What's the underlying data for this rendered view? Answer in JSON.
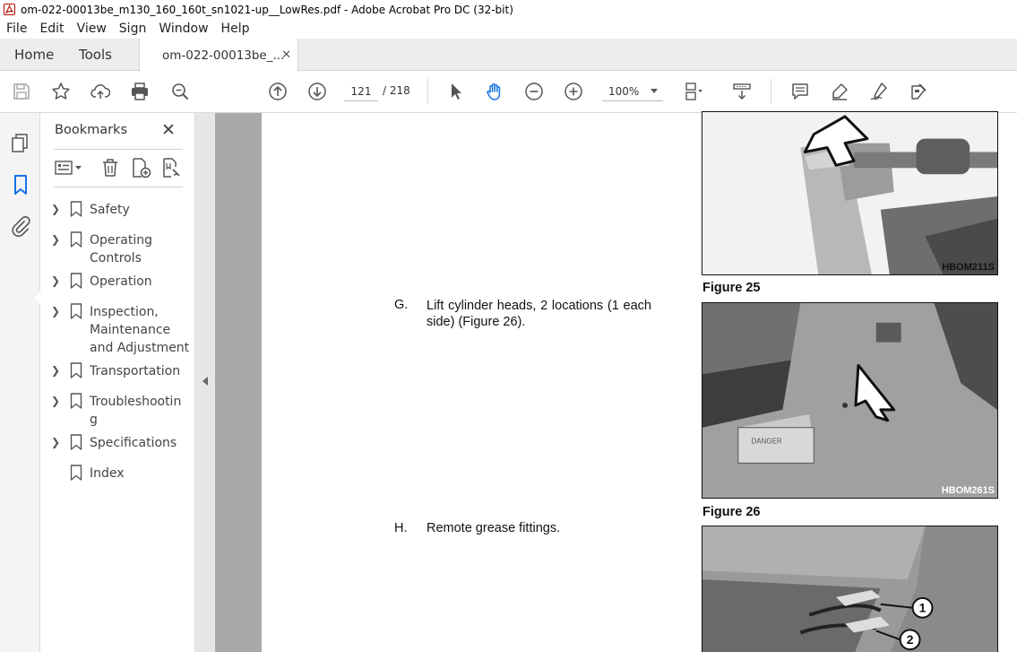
{
  "window": {
    "title": "om-022-00013be_m130_160_160t_sn1021-up__LowRes.pdf - Adobe Acrobat Pro DC (32-bit)"
  },
  "menu": [
    "File",
    "Edit",
    "View",
    "Sign",
    "Window",
    "Help"
  ],
  "tabs": {
    "home": "Home",
    "tools": "Tools",
    "document": "om-022-00013be_..."
  },
  "toolbar": {
    "current_page": "121",
    "total_pages": "/ 218",
    "zoom": "100%"
  },
  "bookmarks": {
    "title": "Bookmarks",
    "items": [
      {
        "label": "Safety",
        "expandable": true
      },
      {
        "label": "Operating Controls",
        "expandable": true
      },
      {
        "label": "Operation",
        "expandable": true
      },
      {
        "label": "Inspection, Maintenance and Adjustment",
        "expandable": true
      },
      {
        "label": "Transportation",
        "expandable": true
      },
      {
        "label": "Troubleshooting",
        "expandable": true
      },
      {
        "label": "Specifications",
        "expandable": true
      },
      {
        "label": "Index",
        "expandable": false
      }
    ]
  },
  "document": {
    "step_g": {
      "letter": "G.",
      "text": "Lift cylinder heads, 2 locations (1 each side) (Figure 26)."
    },
    "step_h": {
      "letter": "H.",
      "text": "Remote grease fittings."
    },
    "figures": [
      {
        "caption": "Figure 25",
        "code": "HBOM211S"
      },
      {
        "caption": "Figure 26",
        "code": "HBOM261S"
      },
      {
        "caption": "",
        "code": ""
      }
    ],
    "callouts": [
      "1",
      "2"
    ],
    "decal_text": "DANGER"
  },
  "colors": {
    "accent_blue": "#1473e6",
    "doc_background": "#a9a9a9"
  }
}
